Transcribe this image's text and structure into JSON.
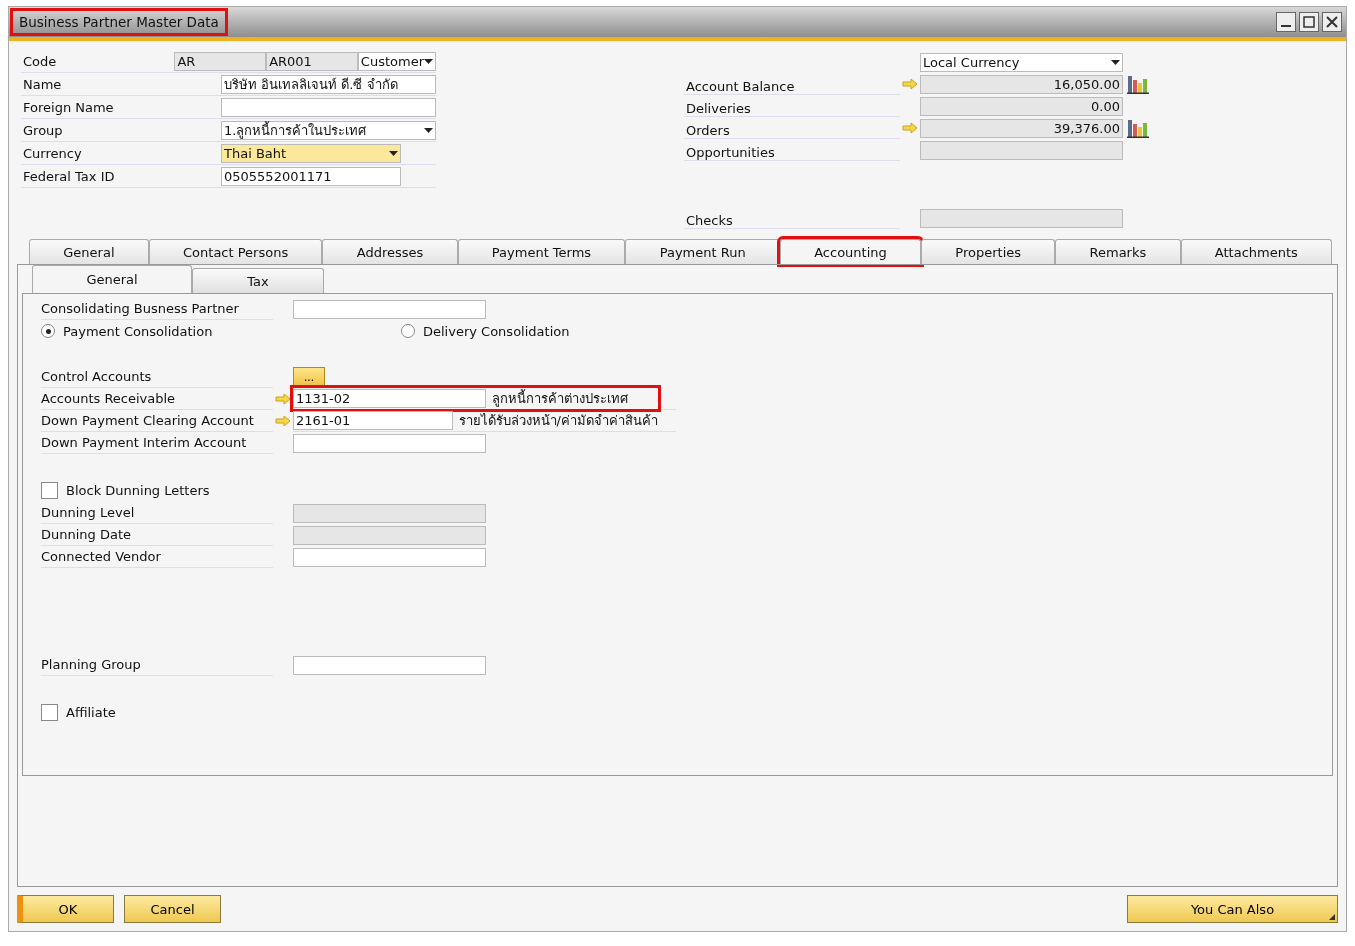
{
  "window": {
    "title": "Business Partner Master Data",
    "title_highlighted": true
  },
  "header_fields": [
    {
      "label": "Code",
      "kind": "code",
      "values": [
        "AR",
        "AR001"
      ],
      "type_value": "Customer"
    },
    {
      "label": "Name",
      "kind": "text",
      "value": "บริษัท อินเทลลิเจนท์ ดี.ซี จำกัด"
    },
    {
      "label": "Foreign Name",
      "kind": "text"
    },
    {
      "label": "Group",
      "kind": "select",
      "value": "1.ลูกหนี้การค้าในประเทศ"
    },
    {
      "label": "Currency",
      "kind": "short-select",
      "value": "Thai Baht",
      "focused": true
    },
    {
      "label": "Federal Tax ID",
      "kind": "short-text",
      "value": "0505552001171"
    }
  ],
  "balance": {
    "currency": "Local Currency",
    "rows": [
      {
        "label": "Account Balance",
        "value": "16,050.00",
        "linked": true,
        "chart": true
      },
      {
        "label": "Deliveries",
        "value": "0.00",
        "linked": false,
        "chart": false
      },
      {
        "label": "Orders",
        "value": "39,376.00",
        "linked": true,
        "chart": true
      },
      {
        "label": "Opportunities",
        "linked": false,
        "chart": false
      }
    ],
    "checks_label": "Checks"
  },
  "tabs": [
    {
      "label": "General",
      "selected": false,
      "highlighted": false
    },
    {
      "label": "Contact Persons",
      "selected": false,
      "highlighted": false
    },
    {
      "label": "Addresses",
      "selected": false,
      "highlighted": false
    },
    {
      "label": "Payment Terms",
      "selected": false,
      "highlighted": false
    },
    {
      "label": "Payment Run",
      "selected": false,
      "highlighted": false
    },
    {
      "label": "Accounting",
      "selected": true,
      "highlighted": true
    },
    {
      "label": "Properties",
      "selected": false,
      "highlighted": false
    },
    {
      "label": "Remarks",
      "selected": false,
      "highlighted": false
    },
    {
      "label": "Attachments",
      "selected": false,
      "highlighted": false
    }
  ],
  "subtabs": [
    {
      "label": "General",
      "selected": true
    },
    {
      "label": "Tax",
      "selected": false
    }
  ],
  "sections": [
    [
      {
        "kind": "field",
        "label": "Consolidating Busness Partner",
        "disabled": false
      },
      {
        "kind": "radios",
        "options": [
          {
            "label": "Payment Consolidation",
            "selected": true
          },
          {
            "label": "Delivery Consolidation",
            "selected": false
          }
        ]
      }
    ],
    [
      {
        "kind": "button",
        "label": "Control Accounts",
        "button": "..."
      },
      {
        "kind": "account",
        "label": "Accounts Receivable",
        "value": "1131-02",
        "description": "ลูกหนี้การค้าต่างประเทศ",
        "linked": true,
        "highlighted": true
      },
      {
        "kind": "account",
        "label": "Down Payment Clearing Account",
        "value": "2161-01",
        "description": "รายได้รับล่วงหน้า/ค่ามัดจำค่าสินค้า",
        "linked": true,
        "highlighted": false
      },
      {
        "kind": "field",
        "label": "Down Payment Interim Account",
        "disabled": false
      }
    ],
    [
      {
        "kind": "checkbox",
        "label": "Block Dunning Letters",
        "checked": false
      },
      {
        "kind": "field",
        "label": "Dunning Level",
        "disabled": true
      },
      {
        "kind": "field",
        "label": "Dunning Date",
        "disabled": true
      },
      {
        "kind": "field",
        "label": "Connected Vendor",
        "disabled": false
      }
    ],
    [
      {
        "kind": "field",
        "label": "Planning Group",
        "disabled": false
      }
    ],
    [
      {
        "kind": "checkbox",
        "label": "Affiliate",
        "checked": false
      }
    ]
  ],
  "buttons": [
    {
      "label": "OK",
      "kind": "left"
    },
    {
      "label": "Cancel",
      "kind": "left"
    },
    {
      "label": "You Can Also",
      "kind": "menu"
    }
  ]
}
